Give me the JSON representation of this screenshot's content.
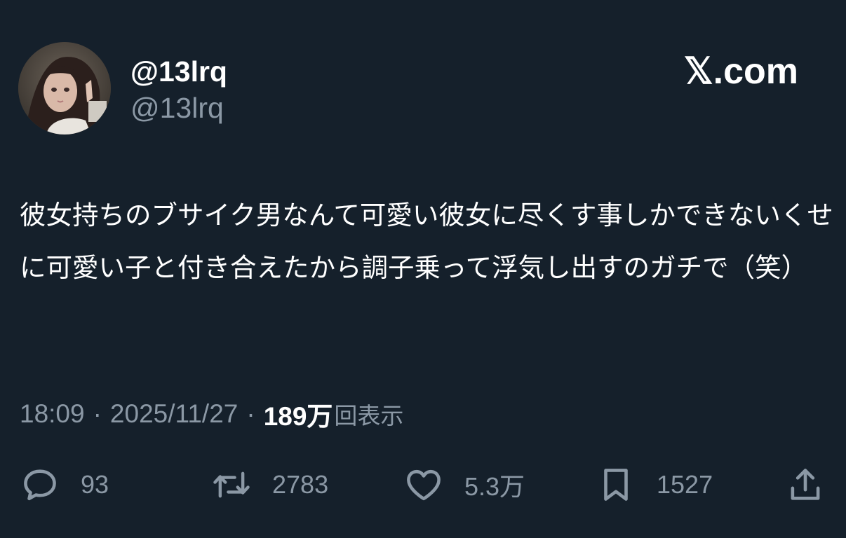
{
  "author": {
    "display_name": "@13lrq",
    "handle": "@13lrq"
  },
  "brand": "𝕏.com",
  "tweet": {
    "text": "彼女持ちのブサイク男なんて可愛い彼女に尽くす事しかできないくせに可愛い子と付き合えたから調子乗って浮気し出すのガチで（笑）"
  },
  "meta": {
    "time": "18:09",
    "separator": "·",
    "date": "2025/11/27",
    "views_count": "189万",
    "views_label": "回表示"
  },
  "actions": {
    "replies": "93",
    "retweets": "2783",
    "likes": "5.3万",
    "bookmarks": "1527"
  },
  "icons": {
    "reply": "reply-icon",
    "retweet": "retweet-icon",
    "like": "heart-icon",
    "bookmark": "bookmark-icon",
    "share": "share-icon"
  },
  "colors": {
    "background": "#15202b",
    "text_primary": "#ffffff",
    "text_secondary": "#8b98a5"
  }
}
